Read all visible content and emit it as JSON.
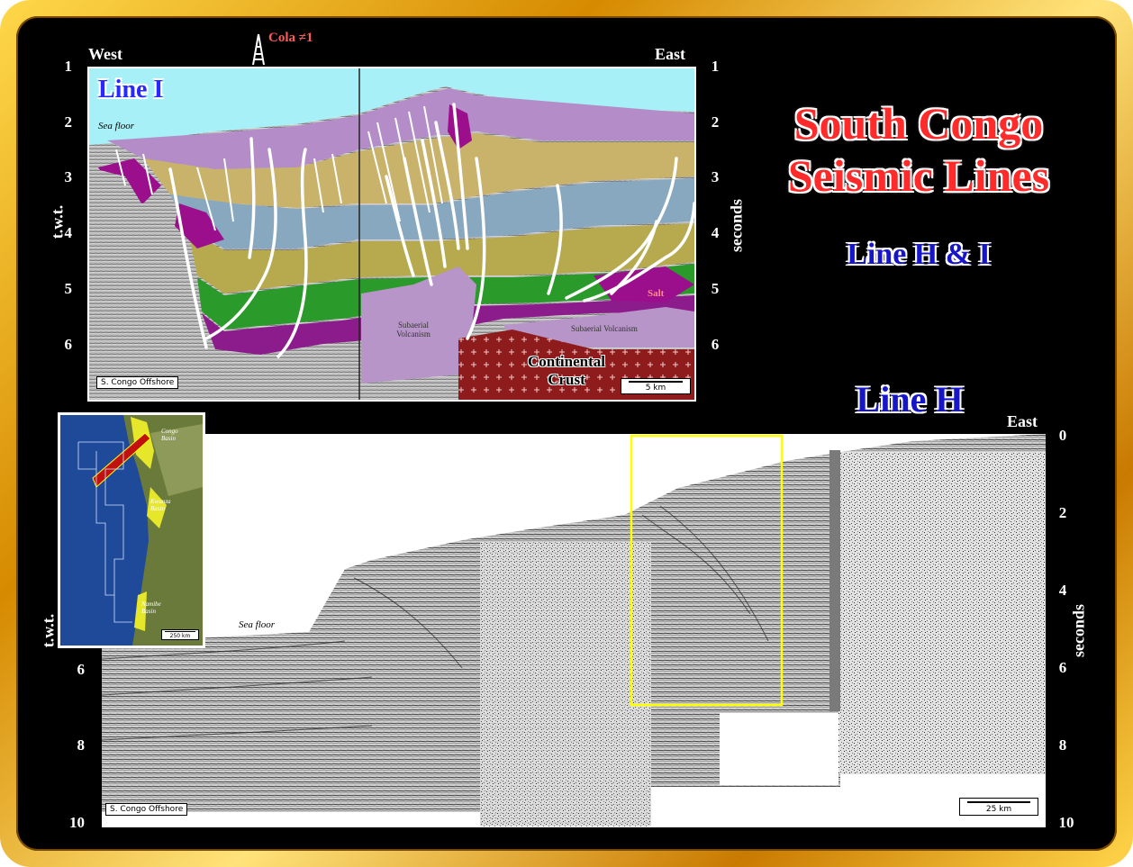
{
  "title": {
    "line1": "South Congo",
    "line2": "Seismic Lines",
    "subtitle": "Line H & I"
  },
  "line_i": {
    "name": "Line I",
    "west": "West",
    "east": "East",
    "well": "Cola ≠1",
    "sea_floor": "Sea floor",
    "salt": "Salt",
    "continental_crust_1": "Continental",
    "continental_crust_2": "Crust",
    "subaerial_1": "Subaerial Volcanism",
    "subaerial_2": "Subaerial Volcanism",
    "offshore_tag": "S. Congo Offshore",
    "scale": "5 km",
    "left_axis_label": "t.w.t.",
    "right_axis_label": "seconds",
    "ticks": [
      "1",
      "2",
      "3",
      "4",
      "5",
      "6"
    ]
  },
  "line_h": {
    "name": "Line H",
    "east": "East",
    "sea_floor": "Sea floor",
    "offshore_tag": "S. Congo Offshore",
    "scale": "25 km",
    "left_axis_label": "t.w.t.",
    "right_axis_label": "seconds",
    "left_ticks": [
      "6",
      "8",
      "10"
    ],
    "right_ticks": [
      "0",
      "2",
      "4",
      "6",
      "8",
      "10"
    ]
  },
  "map": {
    "basin_1": "Congo Basin",
    "basin_2": "Kwanza Basin",
    "basin_3": "Namibe Basin",
    "scale": "250 km"
  },
  "colors": {
    "frame_gold": "#e0a000",
    "title_red": "#ff2a2a",
    "title_blue": "#1616c8",
    "highlight_box": "#ffff00",
    "salt": "#9b0e8c",
    "crust": "#8e1c1c"
  }
}
